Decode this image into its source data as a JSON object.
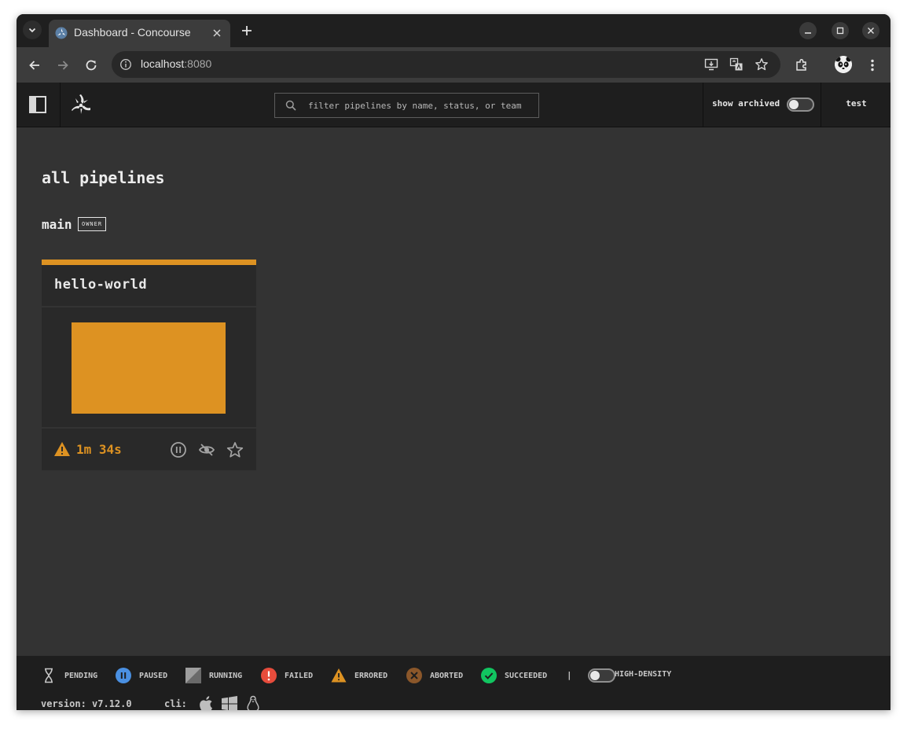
{
  "browser": {
    "tab": {
      "title": "Dashboard - Concourse"
    },
    "address": {
      "host": "localhost",
      "port": ":8080"
    }
  },
  "topbar": {
    "search_placeholder": "filter pipelines by name, status, or team",
    "show_archived_label": "show archived",
    "show_archived_on": false,
    "user": "test"
  },
  "dashboard": {
    "title": "all pipelines",
    "team": {
      "name": "main",
      "role": "OWNER"
    },
    "pipeline": {
      "name": "hello-world",
      "status": "errored",
      "duration": "1m 34s",
      "status_color": "#dd9222"
    }
  },
  "legend": {
    "items": [
      {
        "label": "PENDING",
        "icon": "hourglass-icon"
      },
      {
        "label": "PAUSED",
        "icon": "paused-icon",
        "color": "#4a90e2"
      },
      {
        "label": "RUNNING",
        "icon": "running-icon"
      },
      {
        "label": "FAILED",
        "icon": "failed-icon",
        "color": "#e74c3c"
      },
      {
        "label": "ERRORED",
        "icon": "errored-icon",
        "color": "#dd9222"
      },
      {
        "label": "ABORTED",
        "icon": "aborted-icon",
        "color": "#8b572a"
      },
      {
        "label": "SUCCEEDED",
        "icon": "succeeded-icon",
        "color": "#11c560"
      }
    ],
    "divider": "|",
    "high_density_label": "HIGH-DENSITY",
    "high_density_on": false
  },
  "footer": {
    "version": "version: v7.12.0",
    "cli_label": "cli:",
    "cli_icons": [
      "apple-icon",
      "windows-icon",
      "linux-icon"
    ]
  }
}
